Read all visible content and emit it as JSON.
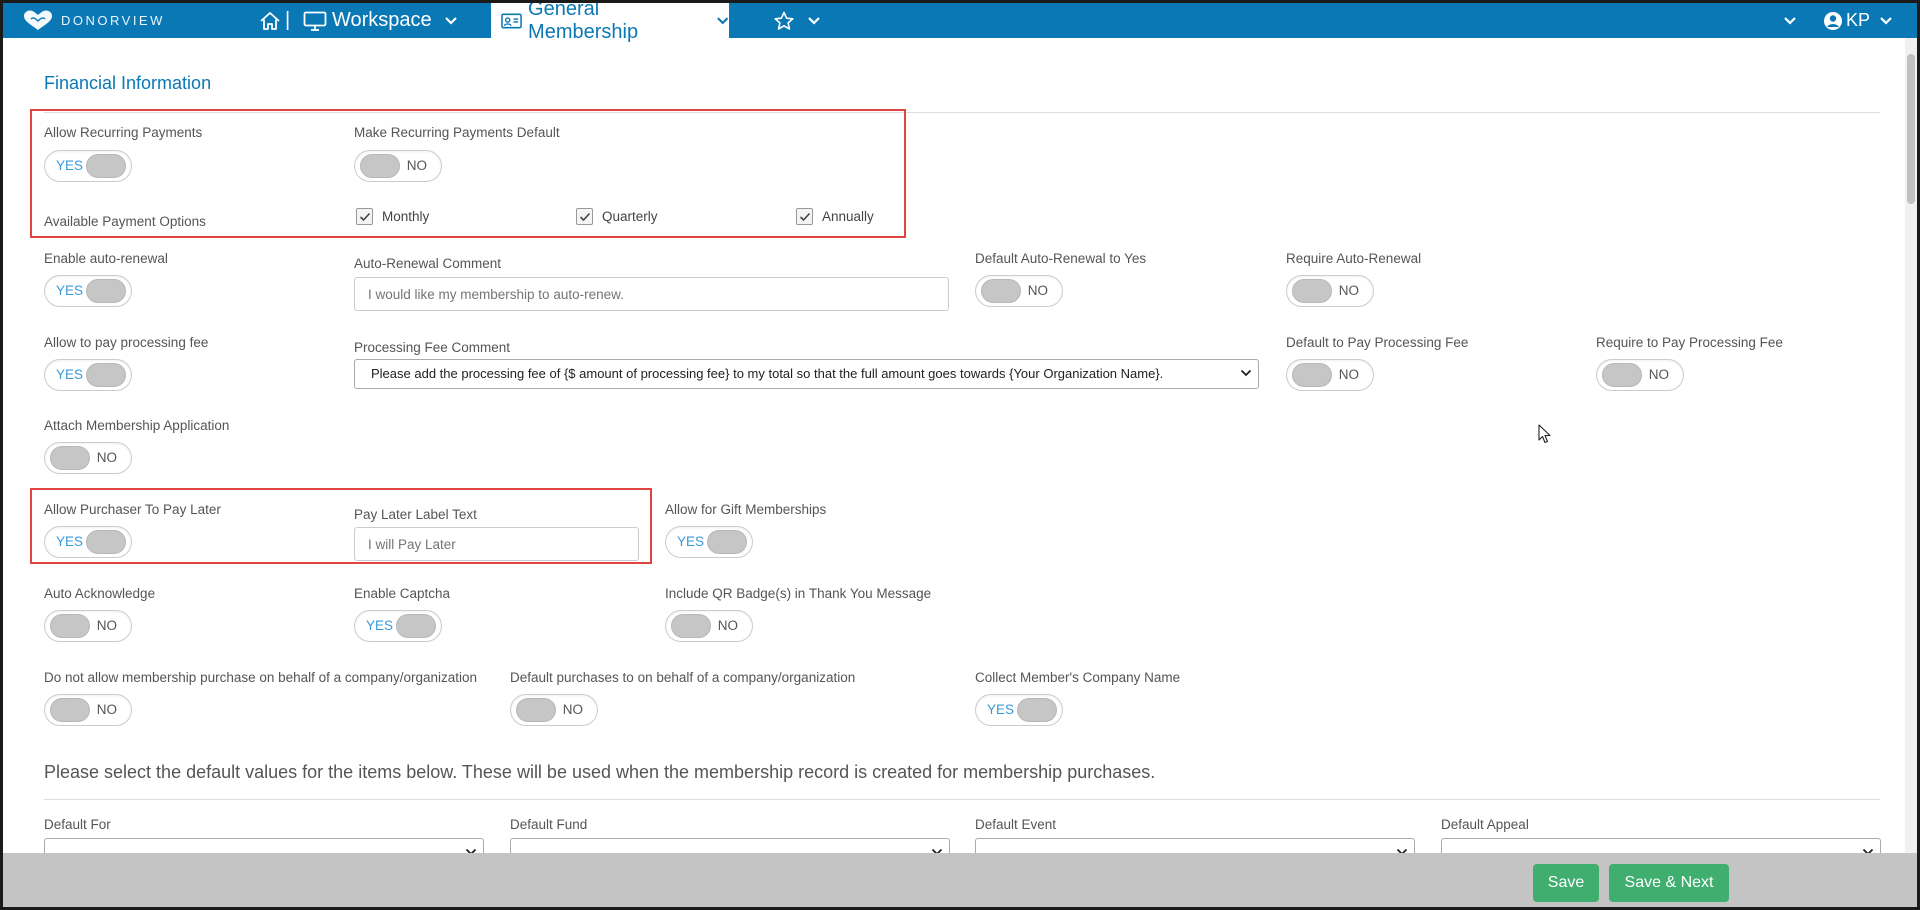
{
  "nav": {
    "logo_text": "DONORVIEW",
    "separator": "|",
    "workspace": "Workspace",
    "membership_tab": "General Membership",
    "user_initials": "KP"
  },
  "section": {
    "title": "Financial Information"
  },
  "recurring": {
    "allow_label": "Allow Recurring Payments",
    "allow_value": "YES",
    "default_label": "Make Recurring Payments Default",
    "default_value": "NO",
    "options_label": "Available Payment Options",
    "monthly": "Monthly",
    "quarterly": "Quarterly",
    "annually": "Annually"
  },
  "auto_renewal": {
    "enable_label": "Enable auto-renewal",
    "enable_value": "YES",
    "comment_label": "Auto-Renewal Comment",
    "comment_placeholder": "I would like my membership to auto-renew.",
    "default_label": "Default Auto-Renewal to Yes",
    "default_value": "NO",
    "require_label": "Require Auto-Renewal",
    "require_value": "NO"
  },
  "processing_fee": {
    "allow_label": "Allow to pay processing fee",
    "allow_value": "YES",
    "comment_label": "Processing Fee Comment",
    "comment_value": "Please add the processing fee of {$ amount of processing fee} to my total so that the full amount goes towards {Your Organization Name}.",
    "default_label": "Default to Pay Processing Fee",
    "default_value": "NO",
    "require_label": "Require to Pay Processing Fee",
    "require_value": "NO"
  },
  "attach_application": {
    "label": "Attach Membership Application",
    "value": "NO"
  },
  "pay_later": {
    "allow_label": "Allow Purchaser To Pay Later",
    "allow_value": "YES",
    "text_label": "Pay Later Label Text",
    "text_placeholder": "I will Pay Later"
  },
  "gift": {
    "label": "Allow for Gift Memberships",
    "value": "YES"
  },
  "acknowledge": {
    "label": "Auto Acknowledge",
    "value": "NO"
  },
  "captcha": {
    "label": "Enable Captcha",
    "value": "YES"
  },
  "qr_badge": {
    "label": "Include QR Badge(s) in Thank You Message",
    "value": "NO"
  },
  "company": {
    "disallow_label": "Do not allow membership purchase on behalf of a company/organization",
    "disallow_value": "NO",
    "default_label": "Default purchases to on behalf of a company/organization",
    "default_value": "NO",
    "collect_label": "Collect Member's Company Name",
    "collect_value": "YES"
  },
  "defaults": {
    "instruction": "Please select the default values for the items below. These will be used when the membership record is created for membership purchases.",
    "for_label": "Default For",
    "fund_label": "Default Fund",
    "event_label": "Default Event",
    "appeal_label": "Default Appeal"
  },
  "footer": {
    "save": "Save",
    "save_next": "Save & Next"
  },
  "colors": {
    "primary": "#0a78b5",
    "toggle_on_text": "#3a9ad9",
    "button_green": "#3fae6e",
    "highlight_red": "#e04545",
    "footer_gray": "#c4c4c4"
  }
}
